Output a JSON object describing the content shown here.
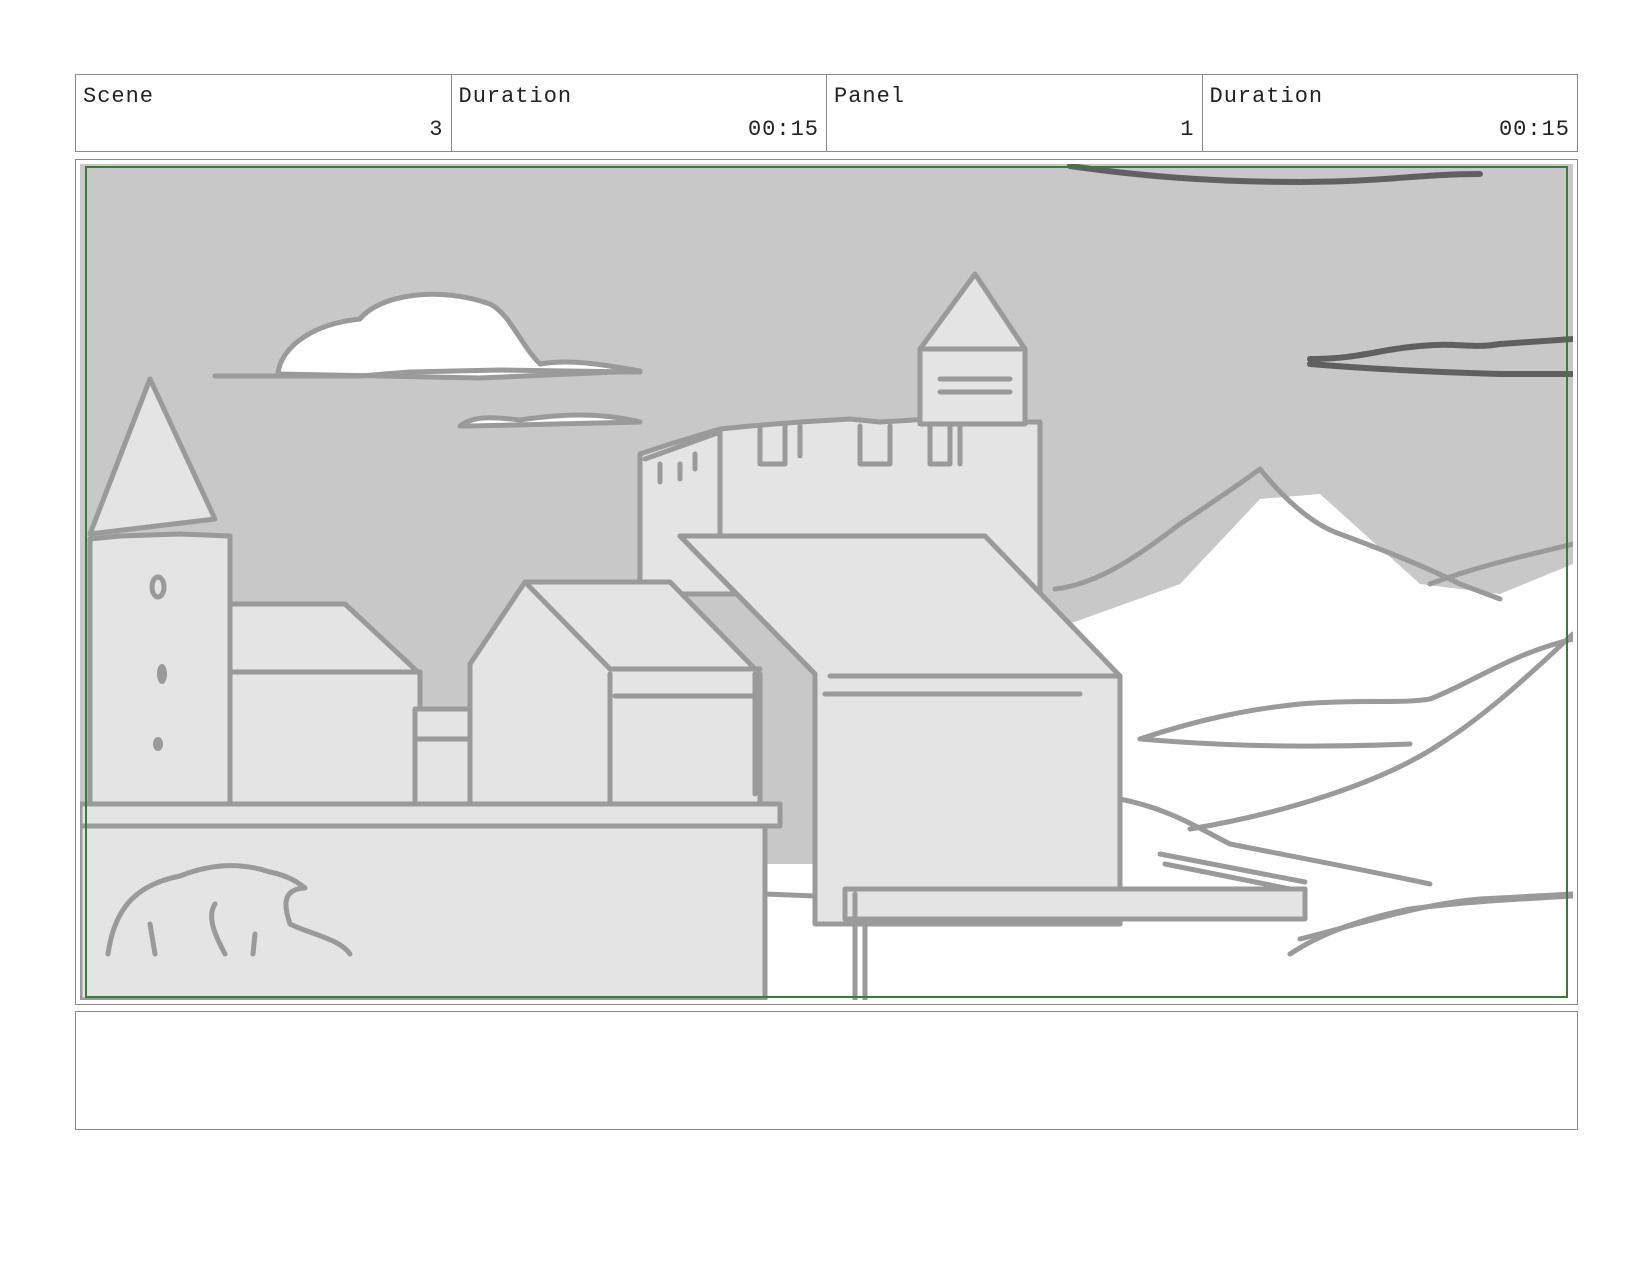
{
  "header": {
    "scene_label": "Scene",
    "scene_value": "3",
    "scene_duration_label": "Duration",
    "scene_duration_value": "00:15",
    "panel_label": "Panel",
    "panel_value": "1",
    "panel_duration_label": "Duration",
    "panel_duration_value": "00:15"
  },
  "colors": {
    "sky": "#c8c8c8",
    "building_fill": "#e4e4e4",
    "line": "#9a9a9a",
    "dark_line": "#606060",
    "frame_guide": "#3c7a3c"
  },
  "notes": {
    "text": ""
  }
}
